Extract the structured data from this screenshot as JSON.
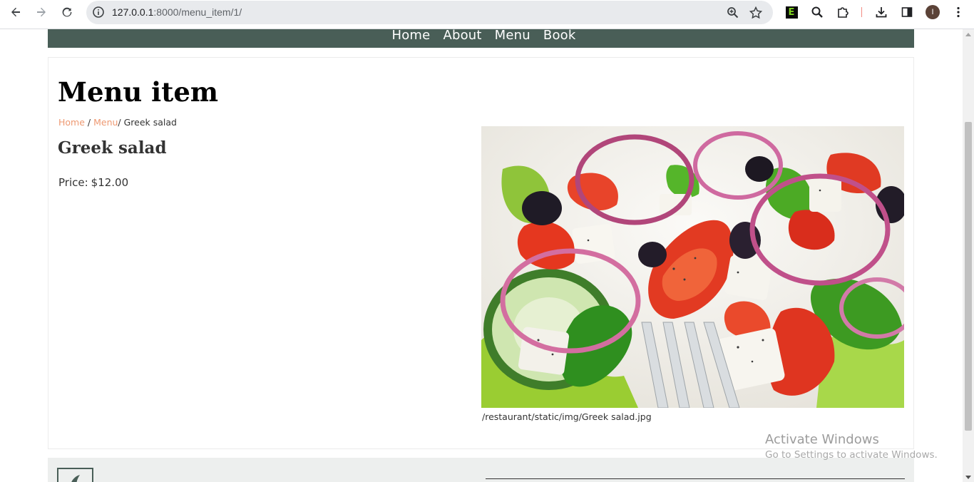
{
  "browser": {
    "url_host": "127.0.0.1",
    "url_rest": ":8000/menu_item/1/",
    "extension_label": "E",
    "profile_initial": "I"
  },
  "nav": {
    "items": [
      "Home",
      "About",
      "Menu",
      "Book"
    ]
  },
  "page": {
    "heading": "Menu item",
    "breadcrumb": {
      "home": "Home",
      "sep1": " / ",
      "menu": "Menu",
      "current": "/ Greek salad"
    },
    "item_name": "Greek salad",
    "price_label": "Price:",
    "price_value": "$12.00",
    "image_caption": "/restaurant/static/img/Greek salad.jpg"
  },
  "watermark": {
    "title": "Activate Windows",
    "subtitle": "Go to Settings to activate Windows."
  },
  "colors": {
    "nav_bg": "#495e57",
    "link": "#ee9972",
    "footer_bg": "#edefee"
  }
}
